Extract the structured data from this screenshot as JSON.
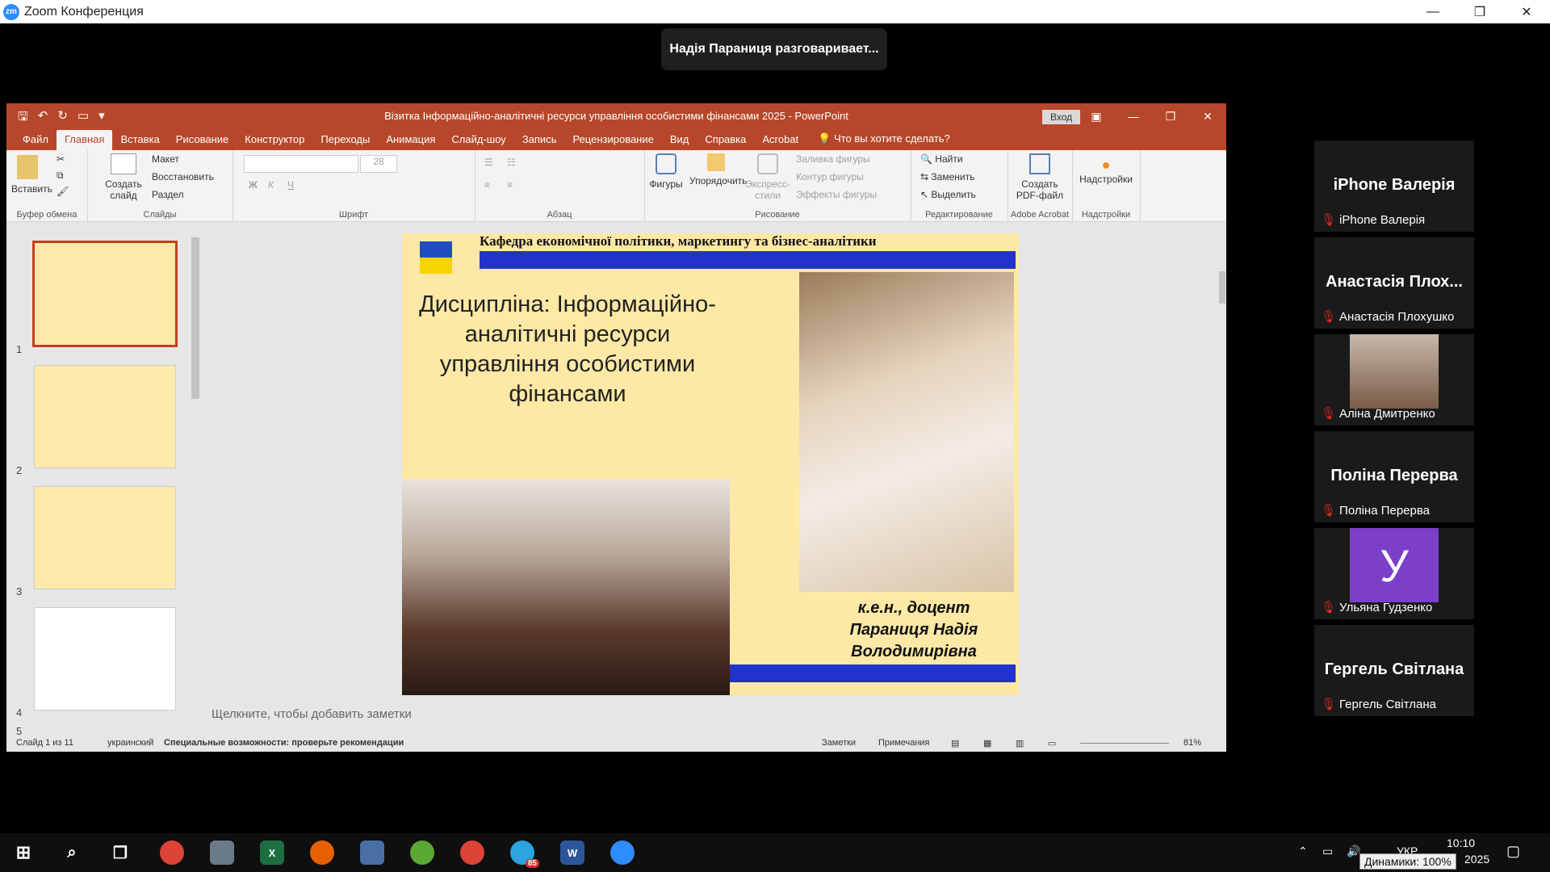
{
  "zoom": {
    "logo": "zm",
    "title": "Zoom Конференция",
    "minimize": "—",
    "restore": "❐",
    "close": "✕",
    "speaking": "Надія Параниця разговаривает..."
  },
  "ppt": {
    "title": "Візитка Інформаційно-аналітичні ресурси управління особистими фінансами 2025  -  PowerPoint",
    "signin": "Вход",
    "tabs": [
      "Файл",
      "Главная",
      "Вставка",
      "Рисование",
      "Конструктор",
      "Переходы",
      "Анимация",
      "Слайд-шоу",
      "Запись",
      "Рецензирование",
      "Вид",
      "Справка",
      "Acrobat"
    ],
    "tellme": "Что вы хотите сделать?",
    "ribbon": {
      "paste": "Вставить",
      "clipboard": "Буфер обмена",
      "new_slide": "Создать слайд",
      "layout": "Макет",
      "reset": "Восстановить",
      "section": "Раздел",
      "slides": "Слайды",
      "font_size": "28",
      "font": "Шрифт",
      "paragraph": "Абзац",
      "shapes": "Фигуры",
      "arrange": "Упорядочить",
      "quick_styles": "Экспресс-стили",
      "shape_fill": "Заливка фигуры",
      "shape_outline": "Контур фигуры",
      "shape_effects": "Эффекты фигуры",
      "drawing": "Рисование",
      "find": "Найти",
      "replace": "Заменить",
      "select": "Выделить",
      "editing": "Редактирование",
      "create_pdf": "Создать PDF-файл",
      "adobe": "Adobe Acrobat",
      "addins": "Надстройки",
      "addins_group": "Надстройки"
    },
    "thumbs": [
      "1",
      "2",
      "3",
      "4",
      "5"
    ],
    "slide": {
      "header": "Кафедра економічної політики, маркетингу та бізнес-аналітики",
      "discipline": "Дисципліна: Інформаційно-аналітичні ресурси управління особистими фінансами",
      "caption1": "к.е.н., доцент",
      "caption2": "Параниця Надія",
      "caption3": "Володимирівна"
    },
    "notes": "Щелкните, чтобы добавить заметки",
    "status": {
      "slide": "Слайд 1 из 11",
      "lang": "украинский",
      "access": "Специальные возможности: проверьте рекомендации",
      "notes": "Заметки",
      "comments": "Примечания",
      "zoom": "81%"
    }
  },
  "participants": [
    {
      "big": "iPhone Валерія",
      "name": "iPhone Валерія"
    },
    {
      "big": "Анастасія Плох...",
      "name": "Анастасія Плохушко"
    },
    {
      "big": "",
      "name": "Аліна Дмитренко"
    },
    {
      "big": "Поліна Перерва",
      "name": "Поліна Перерва"
    },
    {
      "big": "У",
      "name": "Ульяна Гудзенко"
    },
    {
      "big": "Гергель Світлана",
      "name": "Гергель Світлана"
    }
  ],
  "taskbar": {
    "telegram_badge": "85",
    "lang": "УКР",
    "time": "10:10",
    "year": "2025",
    "tooltip": "Динамики: 100%"
  },
  "colors": {
    "ppt_accent": "#b7472a",
    "zoom_blue": "#2d8cff",
    "mute_red": "#e02828"
  }
}
